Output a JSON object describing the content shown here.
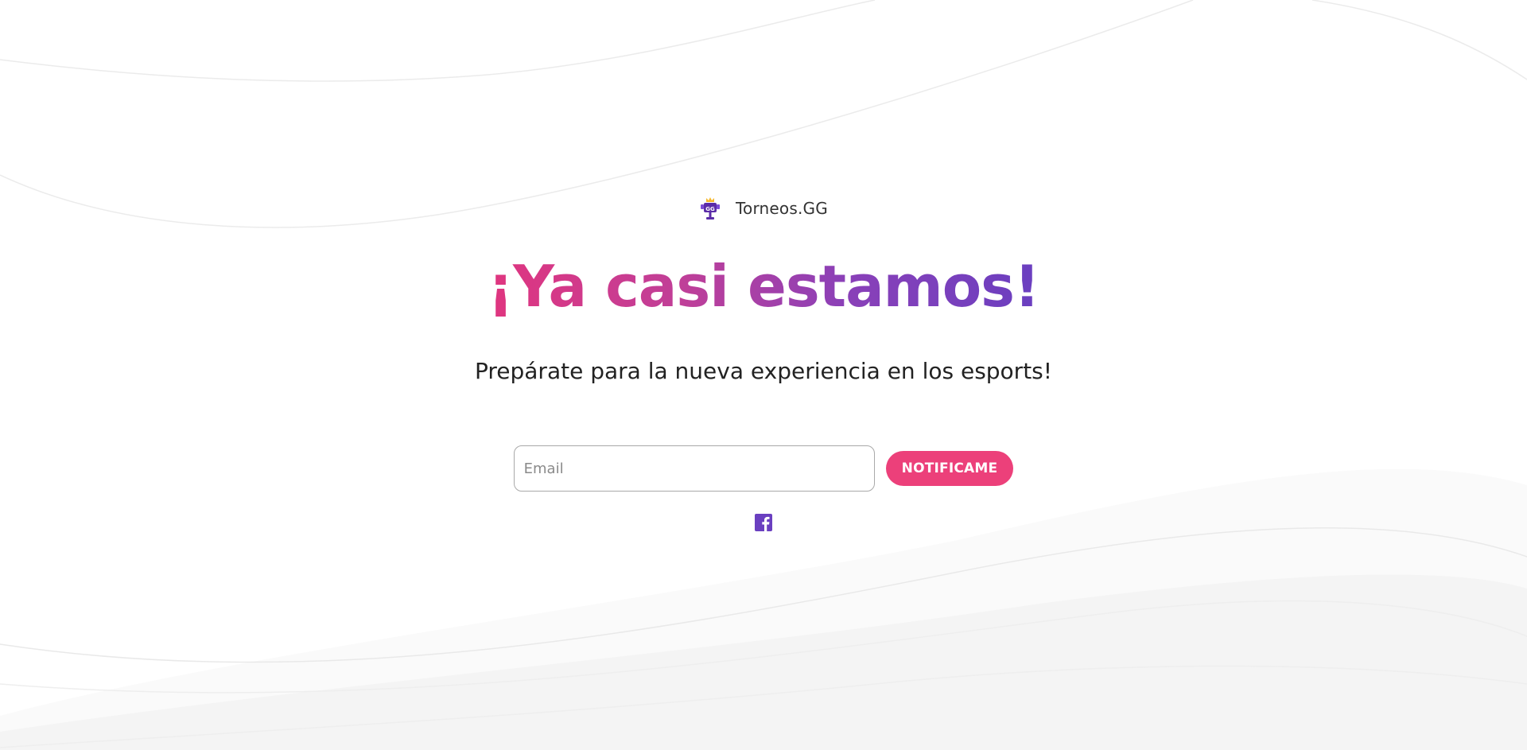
{
  "brand": {
    "name": "Torneos.GG",
    "logo_icon": "trophy-logo-icon"
  },
  "headline": "¡Ya casi estamos!",
  "subtitle": "Prepárate para la nueva experiencia en los esports!",
  "form": {
    "email_placeholder": "Email",
    "email_value": "",
    "submit_label": "NOTIFICAME"
  },
  "social": {
    "facebook_icon": "facebook-icon"
  },
  "colors": {
    "gradient_start": "#e0357f",
    "gradient_end": "#6a3fc0",
    "button": "#ec407a",
    "facebook": "#6a3fc0",
    "text": "#222222"
  }
}
